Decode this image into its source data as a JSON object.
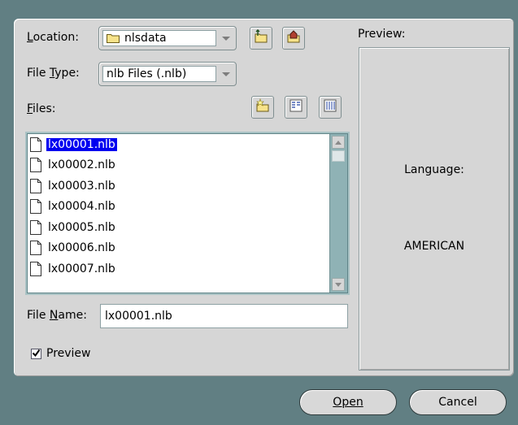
{
  "dialog": {
    "location_label": "Location:",
    "location_value": "nlsdata",
    "filetype_label": "File Type:",
    "filetype_value": "nlb Files (.nlb)",
    "files_label": "Files:",
    "filename_label": "File Name:",
    "filename_value": "lx00001.nlb",
    "preview_checkbox_label": "Preview",
    "preview_checked": true,
    "preview_heading": "Preview:",
    "preview_language_label": "Language:",
    "preview_language_value": "AMERICAN"
  },
  "files": [
    "lx00001.nlb",
    "lx00002.nlb",
    "lx00003.nlb",
    "lx00004.nlb",
    "lx00005.nlb",
    "lx00006.nlb",
    "lx00007.nlb"
  ],
  "selected_index": 0,
  "buttons": {
    "open": "Open",
    "cancel": "Cancel"
  },
  "icons": {
    "up_folder": "folder-up-icon",
    "home": "home-folder-icon",
    "new_folder": "new-folder-icon",
    "list_view": "list-view-icon",
    "details_view": "details-view-icon",
    "file": "file-icon",
    "folder": "folder-icon"
  },
  "colors": {
    "background": "#617f83",
    "panel": "#d6d6d6",
    "selection": "#0000f0",
    "scrollbar": "#8fb2b5"
  }
}
